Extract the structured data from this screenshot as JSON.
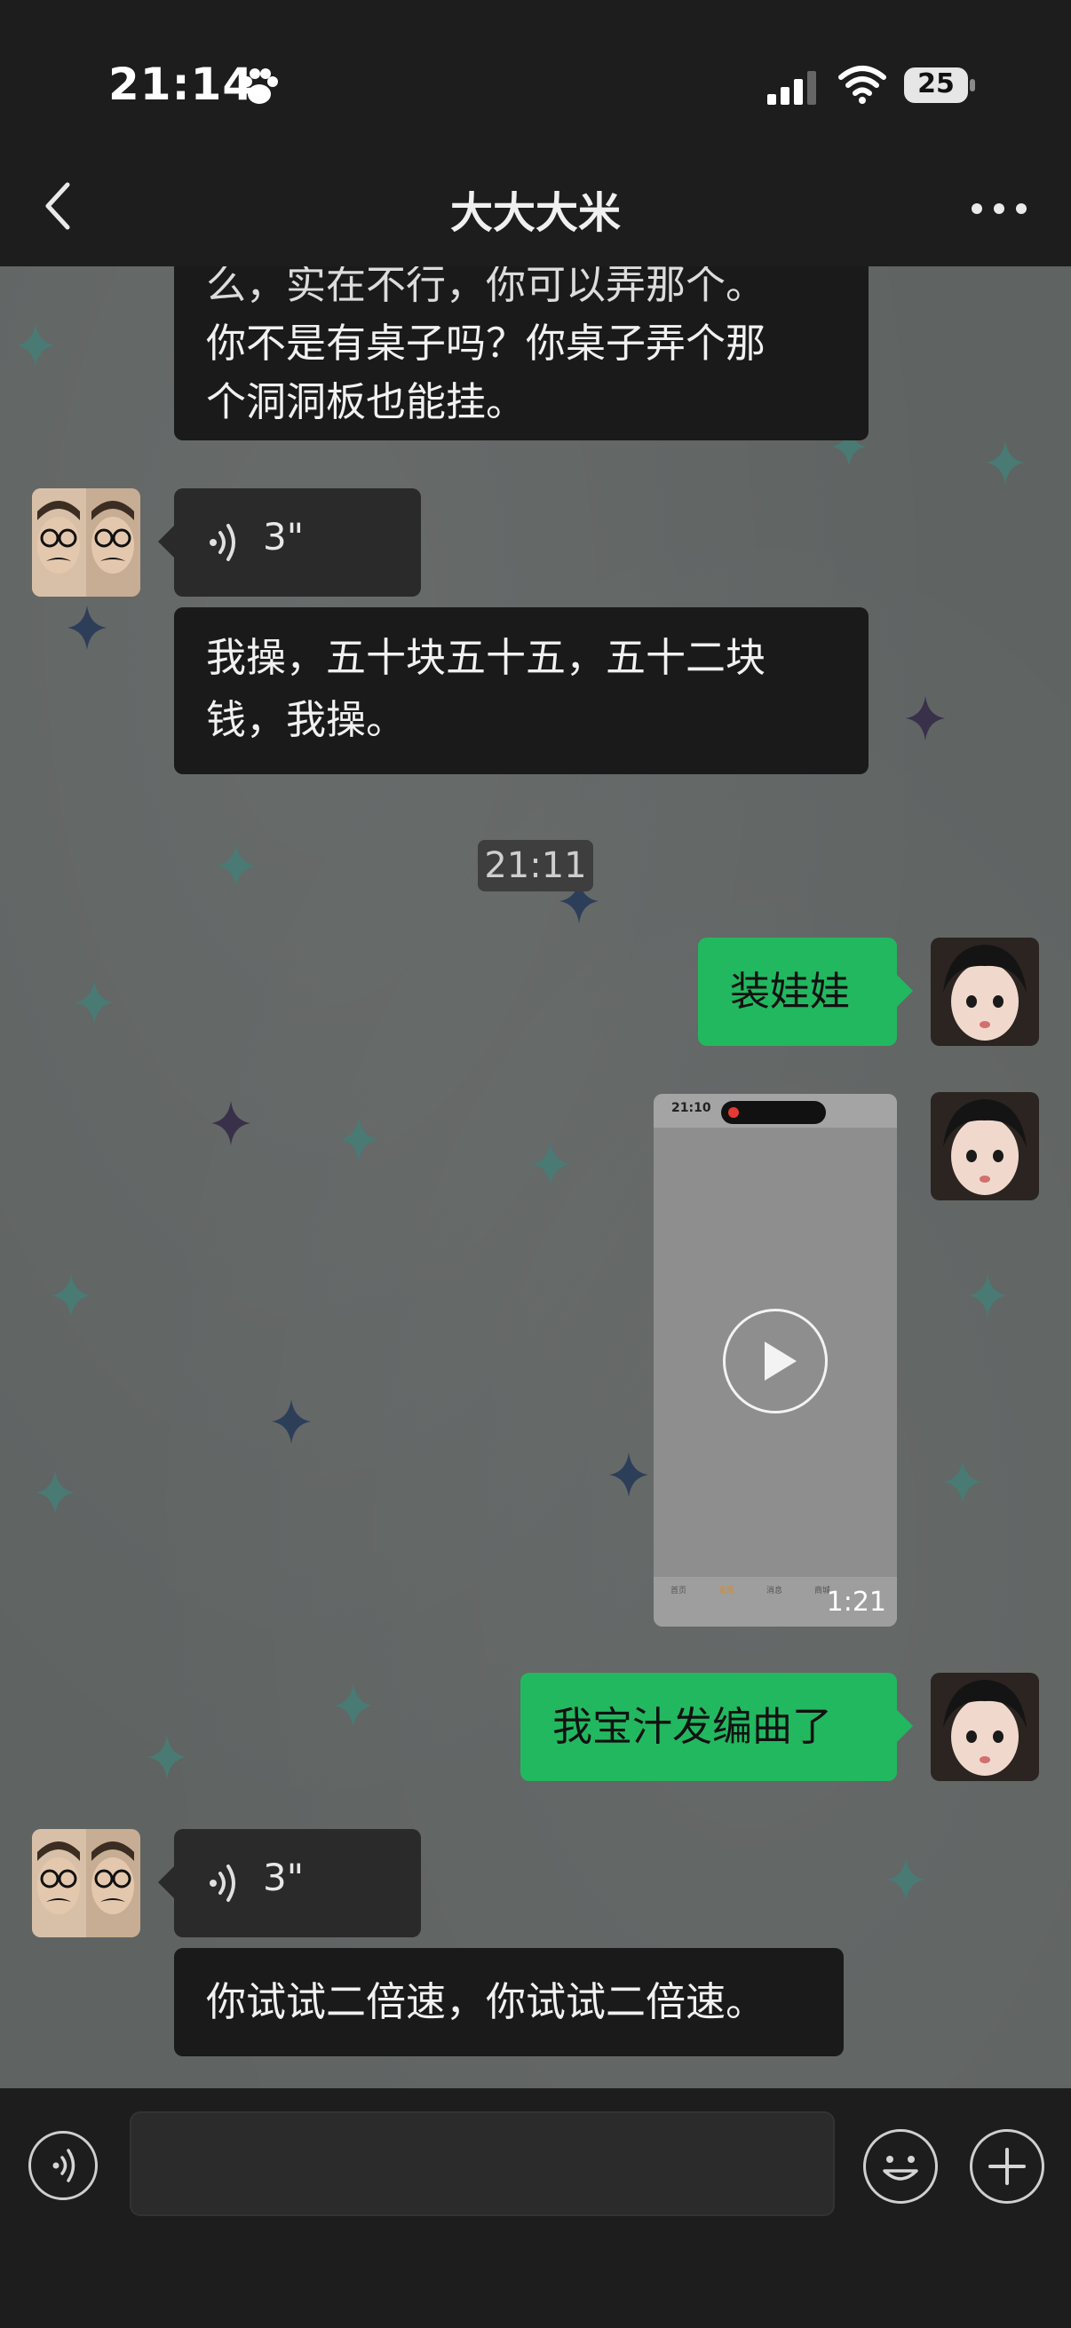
{
  "status_bar": {
    "time": "21:14",
    "battery": "25",
    "icons": [
      "paw-icon",
      "signal-icon",
      "wifi-icon",
      "battery-icon"
    ]
  },
  "nav": {
    "title": "大大大米",
    "back_icon": "chevron-left-icon",
    "more_icon": "more-horizontal-icon"
  },
  "messages": [
    {
      "side": "in",
      "type": "text",
      "line1": "么，实在不行，你可以弄那个。",
      "line2": "你不是有桌子吗？你桌子弄个那",
      "line3": "个洞洞板也能挂。"
    },
    {
      "side": "in",
      "type": "voice",
      "duration": "3\""
    },
    {
      "side": "in",
      "type": "text",
      "line1": "我操，五十块五十五，五十二块",
      "line2": "钱，我操。"
    },
    {
      "type": "time",
      "label": "21:11"
    },
    {
      "side": "out",
      "type": "text",
      "text": "装娃娃"
    },
    {
      "side": "out",
      "type": "video",
      "duration": "1:21",
      "preview_time": "21:10",
      "preview_tabs": [
        "首页",
        "发现",
        "消息",
        "商城"
      ]
    },
    {
      "side": "out",
      "type": "text",
      "text": "我宝汁发编曲了"
    },
    {
      "side": "in",
      "type": "voice",
      "duration": "3\""
    },
    {
      "side": "in",
      "type": "text",
      "text": "你试试二倍速，你试试二倍速。"
    }
  ],
  "input_bar": {
    "voice_icon": "voice-icon",
    "emoji_icon": "emoji-icon",
    "plus_icon": "plus-icon",
    "value": ""
  },
  "colors": {
    "outgoing_bubble": "#22b860",
    "incoming_bubble": "#1a1a1a",
    "chat_background": "#5f6362"
  }
}
